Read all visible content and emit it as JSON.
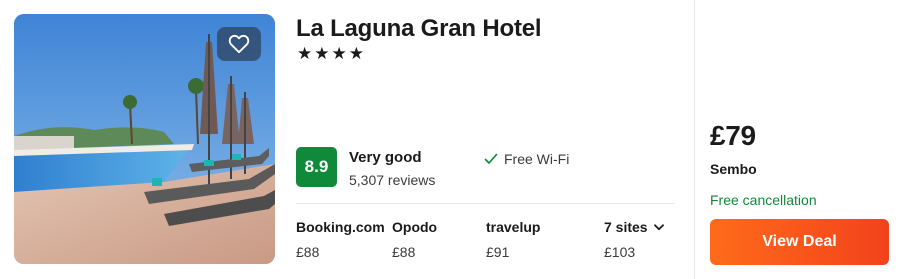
{
  "hotel": {
    "name": "La Laguna Gran Hotel",
    "stars_text": "★★★★",
    "star_count": 4,
    "image_alt": "Hotel pool with sun loungers and umbrellas",
    "favorite_icon": "heart-outline-icon"
  },
  "rating": {
    "score": "8.9",
    "label": "Very good",
    "reviews": "5,307 reviews",
    "badge_color": "#108a3a"
  },
  "amenities": [
    {
      "icon": "check-icon",
      "label": "Free Wi-Fi"
    }
  ],
  "sites": [
    {
      "name": "Booking.com",
      "price": "£88"
    },
    {
      "name": "Opodo",
      "price": "£88"
    },
    {
      "name": "travelup",
      "price": "£91"
    }
  ],
  "more_sites": {
    "label": "7 sites",
    "price": "£103",
    "icon": "chevron-down-icon"
  },
  "deal": {
    "price": "£79",
    "provider": "Sembo",
    "cancellation": "Free cancellation",
    "button_label": "View Deal",
    "button_color": "#f2421c",
    "cancellation_color": "#108a3a"
  }
}
